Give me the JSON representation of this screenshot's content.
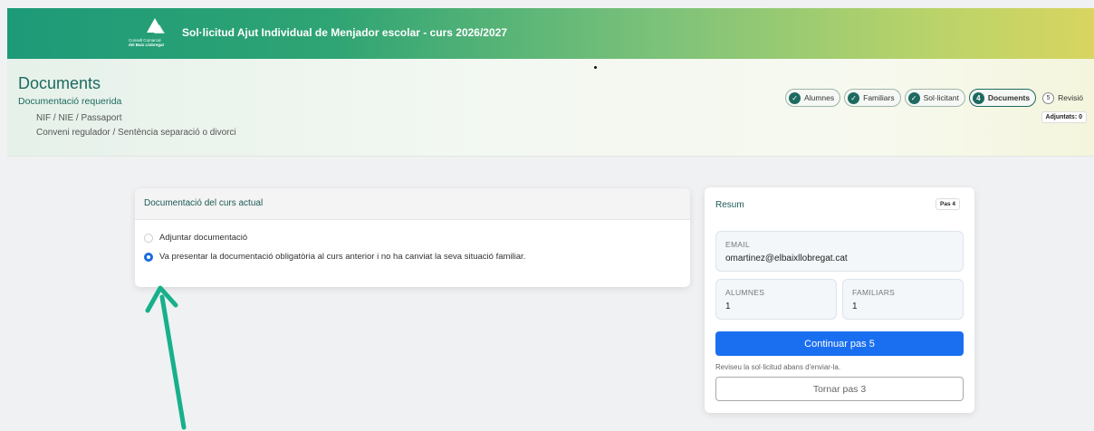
{
  "app": {
    "title": "Sol·licitud Ajut Individual de Menjador escolar - curs 2026/2027",
    "logo_line1": "Consell Comarcal",
    "logo_line2": "del Baix Llobregat"
  },
  "header": {
    "title": "Documents",
    "required_title": "Documentació requerida",
    "required_items": [
      "NIF / NIE / Passaport",
      "Conveni regulador / Sentència separació o divorci"
    ],
    "attachments": "Adjuntats: 0"
  },
  "steps": [
    {
      "label": "Alumnes",
      "marker": "✓"
    },
    {
      "label": "Familiars",
      "marker": "✓"
    },
    {
      "label": "Sol·licitant",
      "marker": "✓"
    },
    {
      "label": "Documents",
      "marker": "4"
    },
    {
      "label": "Revisió",
      "marker": "5"
    }
  ],
  "documents": {
    "title": "Documentació del curs actual",
    "options": [
      {
        "label": "Adjuntar documentació",
        "selected": false
      },
      {
        "label": "Va presentar la documentació obligatòria al curs anterior i no ha canviat la seva situació familiar.",
        "selected": true
      }
    ]
  },
  "summary": {
    "title": "Resum",
    "step_badge": "Pas 4",
    "email_label": "EMAIL",
    "email_value": "omartinez@elbaixllobregat.cat",
    "students_label": "ALUMNES",
    "students_value": "1",
    "family_label": "FAMILIARS",
    "family_value": "1",
    "continue_label": "Continuar pas 5",
    "hint": "Reviseu la sol·licitud abans d'enviar-la.",
    "back_label": "Tornar pas 3"
  },
  "colors": {
    "accent": "#1d6a60",
    "primary_button": "#1a6ff0",
    "annotation_arrow": "#17b08a"
  }
}
